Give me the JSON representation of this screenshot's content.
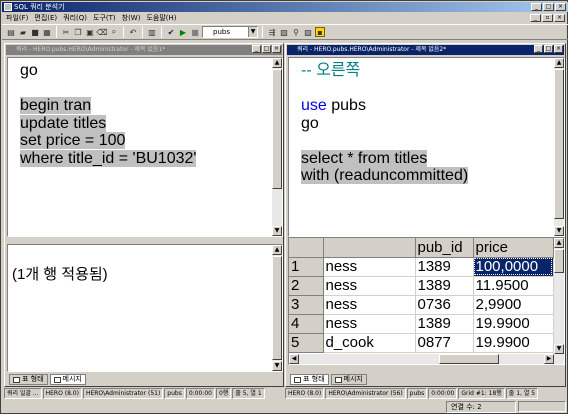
{
  "app": {
    "title": "SQL 쿼리 분석기"
  },
  "menu": [
    "파일(F)",
    "편집(E)",
    "쿼리(Q)",
    "도구(T)",
    "창(W)",
    "도움말(H)"
  ],
  "toolbar": {
    "database": "pubs"
  },
  "left": {
    "title": "쿼리 - HERO.pubs.HERO\\Administrator - 제목 없음1*",
    "code": [
      {
        "text": "go",
        "hl": false
      },
      {
        "text": "",
        "hl": false
      },
      {
        "text": "begin tran",
        "hl": true
      },
      {
        "text": "update titles",
        "hl": true
      },
      {
        "text": "set price = 100",
        "hl": true
      },
      {
        "text": "where title_id = 'BU1032'",
        "hl": true
      }
    ],
    "message": "(1개 행 적용됨)",
    "tab_grid": "표 형태",
    "tab_msg": "메시지",
    "status": [
      "쿼리 일괄 ...",
      "HERO (8.0)",
      "HERO\\Administrator (51)",
      "pubs",
      "0:00:00",
      "0행",
      "줄 5, 열 1"
    ]
  },
  "right": {
    "title": "쿼리 - HERO.pubs.HERO\\Administrator - 제목 없음2*",
    "code": [
      {
        "text": "-- 오른쪽",
        "type": "comment"
      },
      {
        "text": "",
        "type": "plain"
      },
      {
        "kw": "use",
        "text": " pubs",
        "type": "kw"
      },
      {
        "text": "go",
        "type": "plain"
      },
      {
        "text": "",
        "type": "plain"
      },
      {
        "text": "select * from titles",
        "type": "hl"
      },
      {
        "text": "with (readuncommitted)",
        "type": "hl"
      }
    ],
    "grid": {
      "headers": [
        "",
        "pub_id",
        "price"
      ],
      "rows": [
        [
          "1",
          "ness",
          "1389",
          "100,0000"
        ],
        [
          "2",
          "ness",
          "1389",
          "11.9500"
        ],
        [
          "3",
          "ness",
          "0736",
          "2,9900"
        ],
        [
          "4",
          "ness",
          "1389",
          "19.9900"
        ],
        [
          "5",
          "d_cook",
          "0877",
          "19.9900"
        ]
      ]
    },
    "tab_grid": "표 형태",
    "tab_msg": "메시지",
    "status": [
      "HERO (8.0)",
      "HERO\\Administrator (56)",
      "pubs",
      "0:00:00",
      "Grid #1: 18행",
      "줄 1, 열 5"
    ]
  },
  "appstatus": {
    "connections": "연결 수: 2"
  }
}
